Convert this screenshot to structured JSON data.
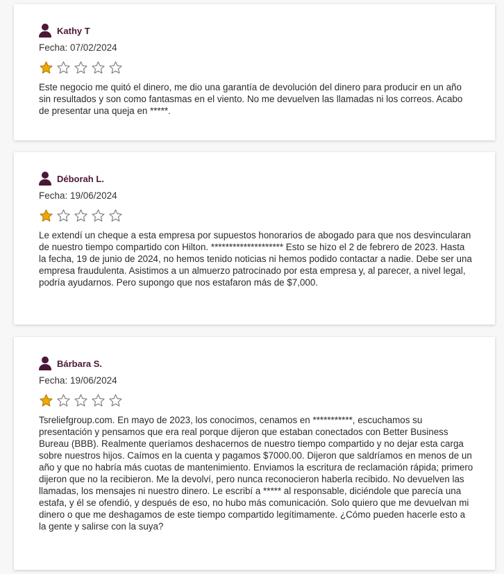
{
  "colors": {
    "accent": "#4a1836",
    "star_filled": "#f0a800",
    "star_empty": "#7a7a7a"
  },
  "reviews": [
    {
      "author": "Kathy T",
      "date": "Fecha: 07/02/2024",
      "rating": 1,
      "max_rating": 5,
      "text": "Este negocio me quitó el dinero, me dio una garantía de devolución del dinero para producir en un año sin resultados y son como fantasmas en el viento. No me devuelven las llamadas ni los correos. Acabo de presentar una queja en *****."
    },
    {
      "author": "Déborah L.",
      "date": "Fecha: 19/06/2024",
      "rating": 1,
      "max_rating": 5,
      "text": "Le extendí un cheque a esta empresa por supuestos honorarios de abogado para que nos desvincularan de nuestro tiempo compartido con Hilton. ******************** Esto se hizo el 2 de febrero de 2023. Hasta la fecha, 19 de junio de 2024, no hemos tenido noticias ni hemos podido contactar a nadie. Debe ser una empresa fraudulenta. Asistimos a un almuerzo patrocinado por esta empresa y, al parecer, a nivel legal, podría ayudarnos. Pero supongo que nos estafaron más de $7,000."
    },
    {
      "author": "Bárbara S.",
      "date": "Fecha: 19/06/2024",
      "rating": 1,
      "max_rating": 5,
      "text": "Tsreliefgroup.com. En mayo de 2023, los conocimos, cenamos en ***********, escuchamos su presentación y pensamos que era real porque dijeron que estaban conectados con Better Business Bureau (BBB). Realmente queríamos deshacernos de nuestro tiempo compartido y no dejar esta carga sobre nuestros hijos. Caímos en la cuenta y pagamos $7000.00. Dijeron que saldríamos en menos de un año y que no habría más cuotas de mantenimiento. Enviamos la escritura de reclamación rápida; primero dijeron que no la recibieron. Me la devolví, pero nunca reconocieron haberla recibido. No devuelven las llamadas, los mensajes ni nuestro dinero. Le escribí a ***** al responsable, diciéndole que parecía una estafa, y él se ofendió, y después de eso, no hubo más comunicación. Solo quiero que me devuelvan mi dinero o que me deshagamos de este tiempo compartido legítimamente. ¿Cómo pueden hacerle esto a la gente y salirse con la suya?"
    }
  ]
}
